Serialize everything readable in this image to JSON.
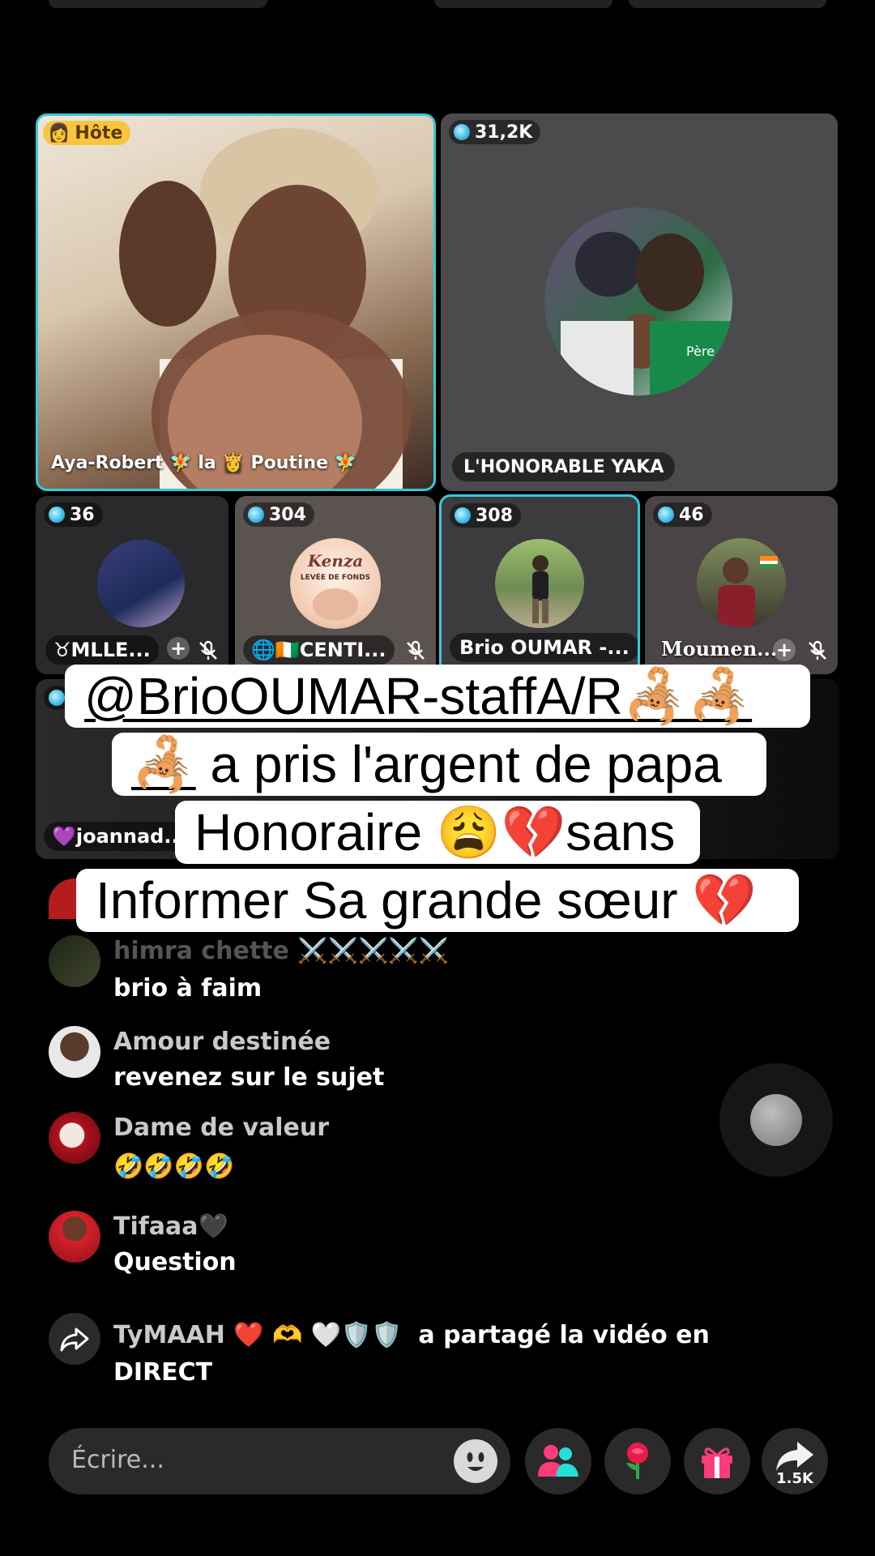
{
  "tiles": {
    "host": {
      "badge": "Hôte",
      "name": "Aya-Robert 🧚 la 👸 Poutine 🧚"
    },
    "guest1": {
      "count": "31,2K",
      "name": "L'HONORABLE YAKA",
      "photo_label": "Père"
    },
    "row2": [
      {
        "count": "36",
        "name": "♉MLLE..."
      },
      {
        "count": "304",
        "name": "🌐🇨🇮CENTI...",
        "poster_title": "Kenza",
        "poster_sub": "LEVÉE DE FONDS"
      },
      {
        "count": "308",
        "name": "Brio OUMAR -..."
      },
      {
        "count": "46",
        "name": "Moumen..."
      }
    ],
    "row3": {
      "name": "💜joannad.."
    }
  },
  "caption": {
    "line1": "@BrioOUMAR-staffA/R🦂🦂",
    "line2_emoji": "🦂",
    "line2_text": " a pris l'argent de papa",
    "line3": "Honoraire 😩💔sans",
    "line4": "Informer Sa grande sœur 💔"
  },
  "comments": [
    {
      "user": "himra chette ⚔️⚔️⚔️⚔️⚔️",
      "text": "brio à faim"
    },
    {
      "user": "Amour destinée",
      "text": "revenez sur le sujet"
    },
    {
      "user": "Dame de valeur",
      "text": "🤣🤣🤣🤣"
    },
    {
      "user": "Tifaaa🖤",
      "text": "Question"
    },
    {
      "user": "TyMAAH ❤️ 🫶 🤍🛡️🛡️",
      "action": "a partagé la vidéo en",
      "action2": "DIRECT"
    }
  ],
  "input": {
    "placeholder": "Écrire..."
  },
  "share": {
    "count": "1.5K"
  },
  "colors": {
    "accent_cyan": "#36c9d6",
    "host_badge": "#f7c53e",
    "gift_pink": "#ff3b7a"
  }
}
